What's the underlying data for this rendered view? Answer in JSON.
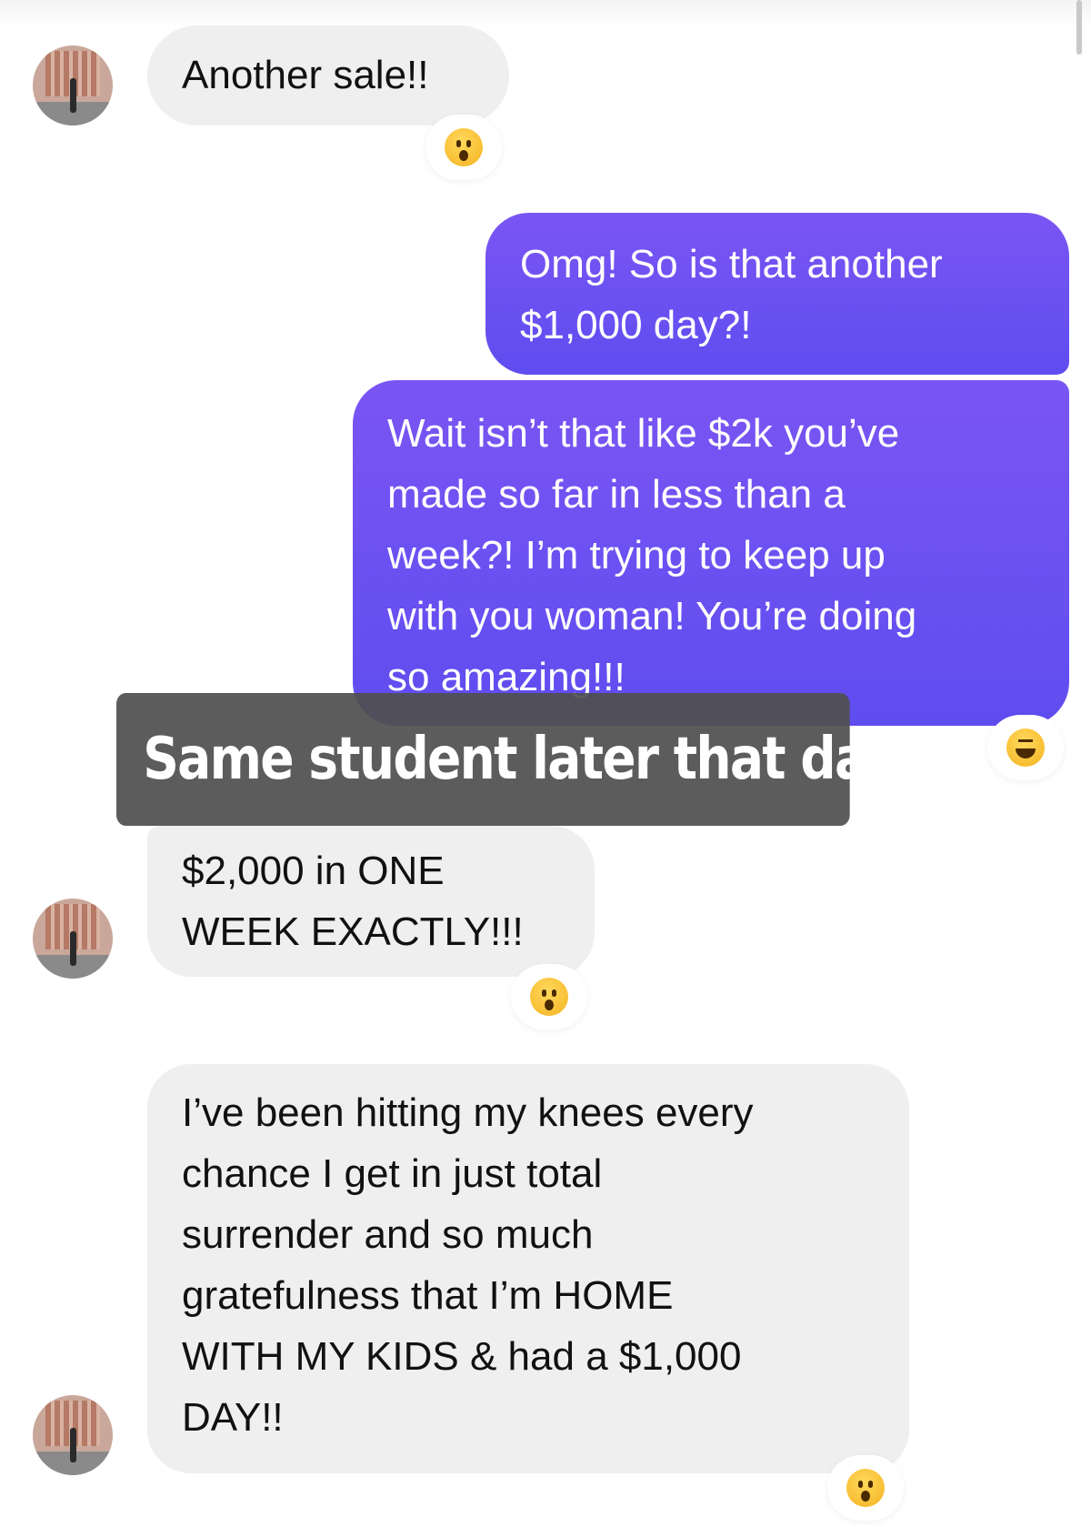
{
  "messages": [
    {
      "side": "incoming",
      "text": "Another sale!!",
      "reaction": "surprised-face"
    },
    {
      "side": "outgoing",
      "lines": [
        "Omg! So is that another",
        "$1,000 day?!"
      ]
    },
    {
      "side": "outgoing",
      "lines": [
        "Wait isn’t that like $2k you’ve",
        "made so far in less than a",
        "week?! I’m trying to keep up",
        "with you woman! You’re doing",
        "so amazing!!!"
      ],
      "reaction": "laughing-face"
    },
    {
      "side": "incoming",
      "lines": [
        "$2,000 in ONE",
        "WEEK EXACTLY!!!"
      ],
      "reaction": "surprised-face"
    },
    {
      "side": "incoming",
      "lines": [
        "I’ve been hitting my knees every",
        "chance I get in just total",
        "surrender and so much",
        "gratefulness that I’m HOME",
        "WITH MY KIDS & had a $1,000",
        "DAY!!"
      ],
      "reaction": "surprised-face"
    }
  ],
  "overlay_caption": "Same student later that day!",
  "colors": {
    "incoming_bubble": "#efefef",
    "outgoing_bubble": "#6b52f2",
    "overlay": "#505050"
  }
}
